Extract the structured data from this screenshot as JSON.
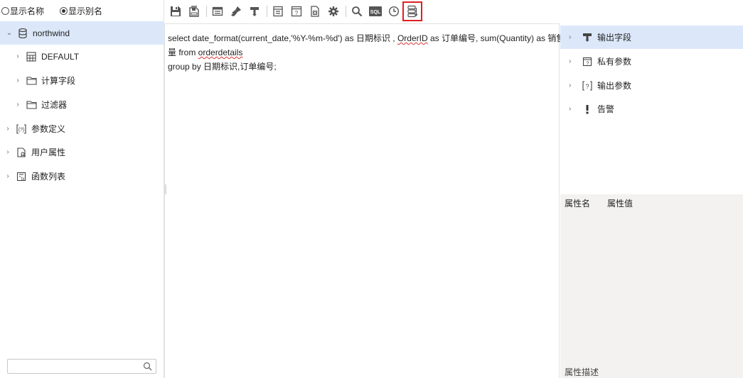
{
  "left": {
    "radio": [
      {
        "label": "显示名称",
        "checked": false
      },
      {
        "label": "显示别名",
        "checked": true
      }
    ],
    "tree": [
      {
        "label": "northwind",
        "icon": "database-icon",
        "chevron": "⌄"
      },
      {
        "label": "DEFAULT",
        "icon": "table-grid-icon",
        "chevron": "›"
      },
      {
        "label": "计算字段",
        "icon": "folder-icon",
        "chevron": "›"
      },
      {
        "label": "过滤器",
        "icon": "folder-icon",
        "chevron": "›"
      },
      {
        "label": "参数定义",
        "icon": "param-def-icon",
        "chevron": "›"
      },
      {
        "label": "用户属性",
        "icon": "user-attr-icon",
        "chevron": "›"
      },
      {
        "label": "函数列表",
        "icon": "function-list-icon",
        "chevron": "›"
      }
    ],
    "search": {
      "placeholder": ""
    }
  },
  "toolbar": {
    "buttons": [
      "save-icon",
      "save-as-icon",
      "table-icon",
      "brush-icon",
      "output-field-icon",
      "form-icon",
      "param-icon",
      "export-icon",
      "gear-icon",
      "search-icon",
      "sql-icon",
      "clock-icon",
      "sql-format-icon"
    ],
    "highlight_color": "#e02020"
  },
  "editor": {
    "line1_a": "select  date_format(current_date,'%Y-%m-%d') as 日期标识 , ",
    "line1_b": "OrderID",
    "line1_c": " as 订单编号,  sum(Quantity) as 销售",
    "line2_a": "量 from ",
    "line2_b": "orderdetails",
    "line3": "group by 日期标识,订单编号;"
  },
  "right": {
    "tree": [
      {
        "label": "输出字段",
        "icon": "output-field-icon"
      },
      {
        "label": "私有参数",
        "icon": "private-param-icon"
      },
      {
        "label": "输出参数",
        "icon": "output-param-icon"
      },
      {
        "label": "告警",
        "icon": "alert-icon"
      }
    ],
    "prop_name": "属性名",
    "prop_value": "属性值",
    "prop_desc": "属性描述"
  },
  "colors": {
    "selection": "#dce8fa",
    "panel_bg": "#f3f2f1",
    "icon": "#555555"
  }
}
